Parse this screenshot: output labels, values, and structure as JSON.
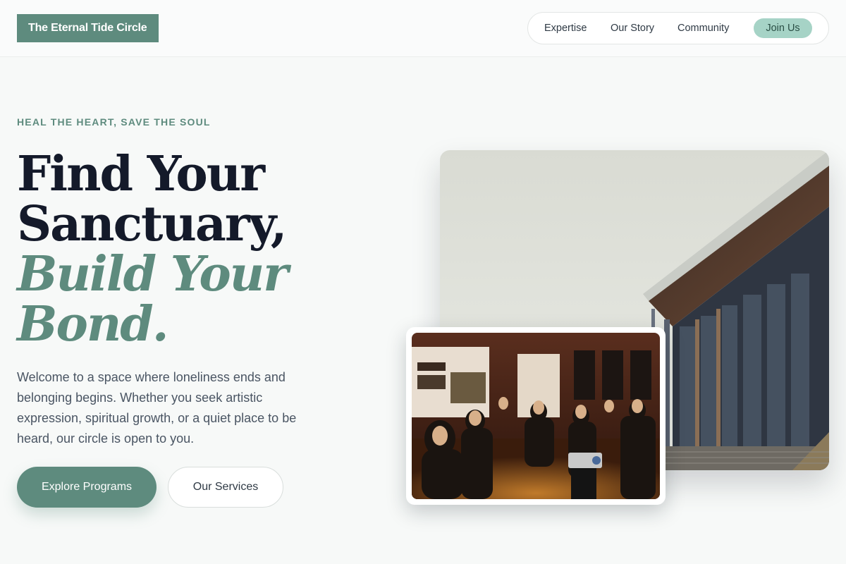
{
  "header": {
    "logo": "The Eternal Tide Circle",
    "nav": [
      "Expertise",
      "Our Story",
      "Community"
    ],
    "cta": "Join Us"
  },
  "hero": {
    "eyebrow": "HEAL THE HEART, SAVE THE SOUL",
    "headline_lines": [
      "Find Your",
      "Sanctuary,"
    ],
    "headline_accent_lines": [
      "Build Your",
      "Bond."
    ],
    "intro": "Welcome to a space where loneliness ends and belonging begins. Whether you seek artistic expression, spiritual growth, or a quiet place to be heard, our circle is open to you.",
    "primary_button": "Explore Programs",
    "secondary_button": "Our Services"
  },
  "colors": {
    "accent": "#5e8b7e",
    "accent_light": "#a6d3c6",
    "headline": "#141a2a",
    "background": "#f7f9f8"
  },
  "images": {
    "main": "modern-building-photo",
    "inset": "community-gathering-photo"
  }
}
